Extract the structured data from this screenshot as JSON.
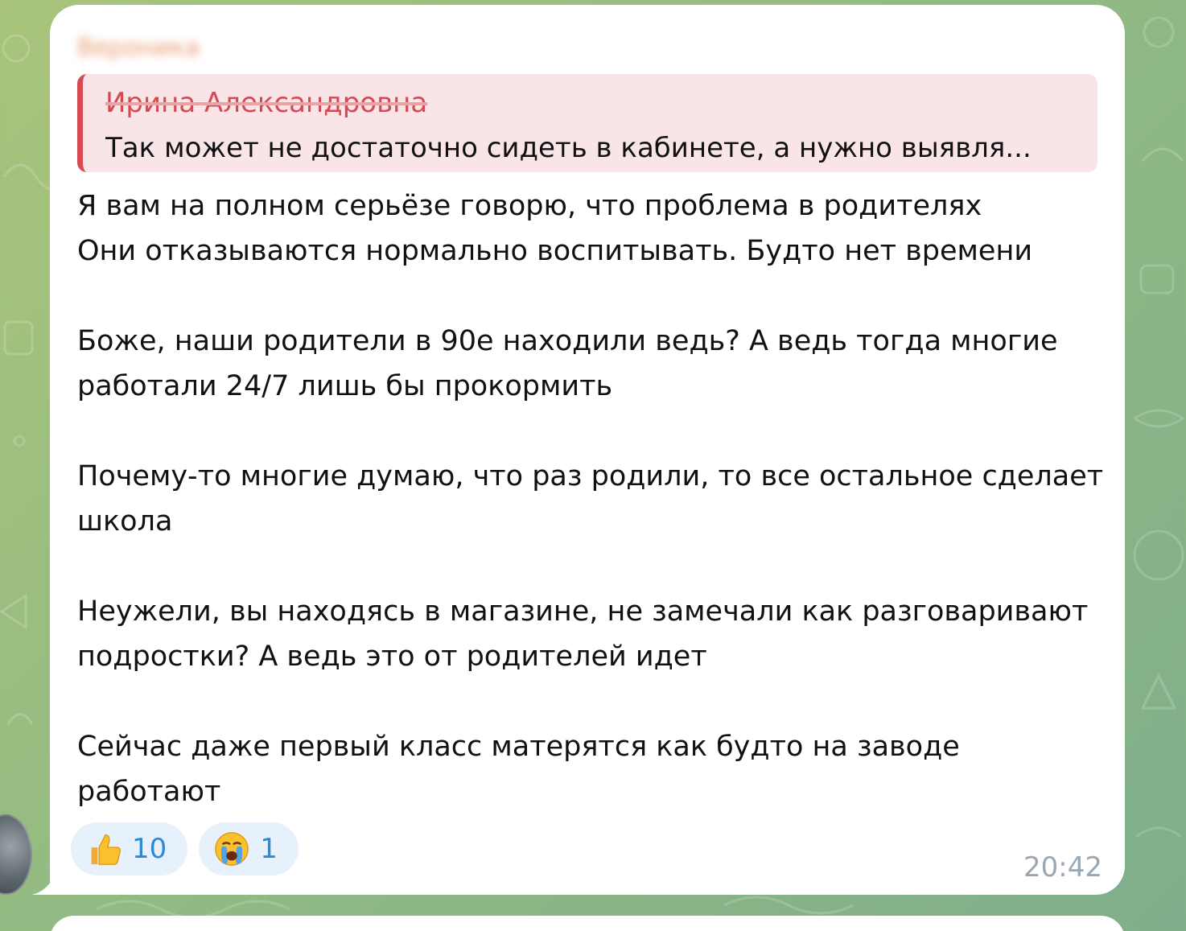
{
  "message": {
    "sender_name": "Вероника",
    "reply": {
      "author": "Ирина Александровна",
      "text": "Так может не достаточно сидеть в кабинете, а нужно выявля..."
    },
    "paragraphs": [
      "Я вам на полном серьёзе говорю, что проблема в родителях\nОни отказываются нормально воспитывать. Будто нет времени",
      "Боже, наши родители в 90е находили ведь? А ведь тогда многие работали 24/7 лишь бы прокормить",
      "Почему-то многие думаю, что раз родили, то все остальное сделает школа",
      "Неужели, вы находясь в магазине, не замечали как разговаривают подростки? А ведь это от родителей идет",
      "Сейчас даже первый класс матерятся как будто на заводе работают"
    ],
    "reactions": [
      {
        "emoji": "thumbs-up",
        "count": "10"
      },
      {
        "emoji": "crying-face",
        "count": "1"
      }
    ],
    "time": "20:42"
  },
  "colors": {
    "reply_accent": "#d84a52",
    "reply_bg": "#f9e5e7",
    "reaction_bg": "#e6f1fb",
    "reaction_count": "#2b8ad6",
    "sender_name": "#e07a3e"
  }
}
